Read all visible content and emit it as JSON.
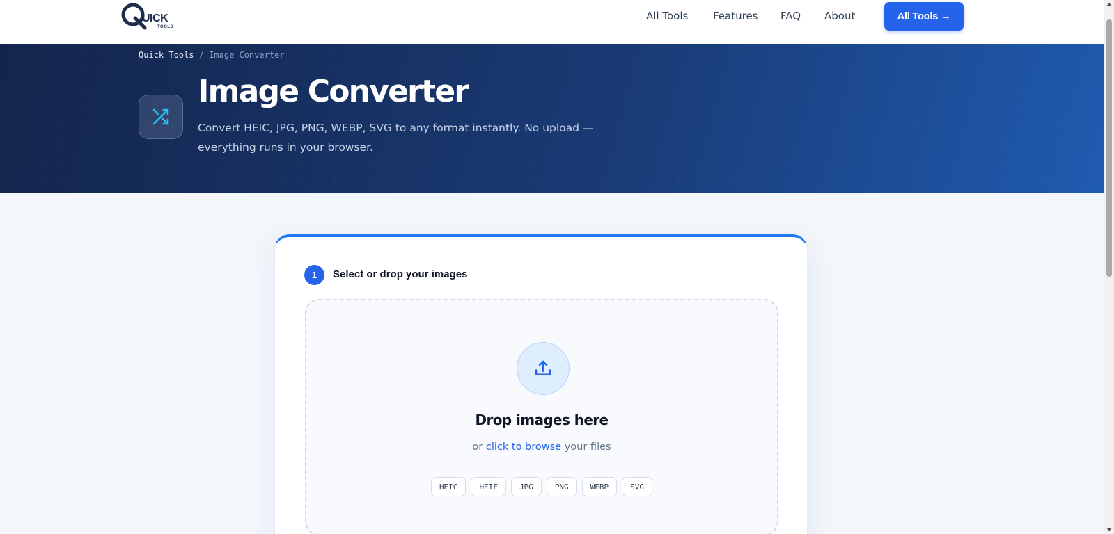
{
  "header": {
    "logo": {
      "word": "UICK",
      "sub": "TOOLS"
    },
    "nav": [
      {
        "label": "All Tools"
      },
      {
        "label": "Features"
      },
      {
        "label": "FAQ"
      },
      {
        "label": "About"
      }
    ],
    "cta_label": "All Tools →"
  },
  "hero": {
    "breadcrumb": {
      "home": "Quick Tools",
      "separator": "/",
      "current": "Image Converter"
    },
    "icon": "shuffle-arrows-icon",
    "title": "Image Converter",
    "subtitle": "Convert HEIC, JPG, PNG, WEBP, SVG to any format instantly. No upload — everything runs in your browser."
  },
  "card": {
    "step_number": "1",
    "step_title": "Select or drop your images",
    "dropzone": {
      "icon": "upload-icon",
      "title": "Drop images here",
      "sub_prefix": "or",
      "browse_link": "click to browse",
      "sub_suffix": "your files",
      "formats": [
        "HEIC",
        "HEIF",
        "JPG",
        "PNG",
        "WEBP",
        "SVG"
      ]
    }
  },
  "colors": {
    "accent": "#2563eb",
    "hero_start": "#13254c",
    "hero_end": "#1f5bb0",
    "page_bg": "#f3f6fa"
  }
}
